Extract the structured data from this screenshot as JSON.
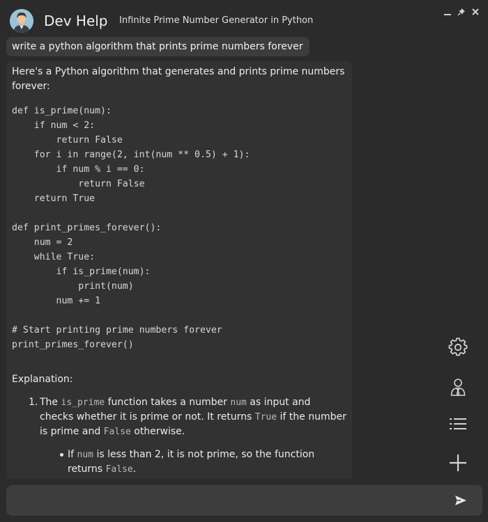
{
  "header": {
    "app_title": "Dev Help",
    "conversation_title": "Infinite Prime Number Generator in Python",
    "window_controls": [
      "minimize-icon",
      "pin-icon",
      "close-icon"
    ]
  },
  "messages": {
    "user": "write a python algorithm that prints prime numbers forever",
    "assistant": {
      "intro": "Here's a Python algorithm that generates and prints prime numbers forever:",
      "code_lines": [
        "def is_prime(num):",
        "    if num < 2:",
        "        return False",
        "    for i in range(2, int(num ** 0.5) + 1):",
        "        if num % i == 0:",
        "            return False",
        "    return True",
        "",
        "def print_primes_forever():",
        "    num = 2",
        "    while True:",
        "        if is_prime(num):",
        "            print(num)",
        "        num += 1",
        "",
        "# Start printing prime numbers forever",
        "print_primes_forever()"
      ],
      "explanation_title": "Explanation:",
      "explanation_items": [
        {
          "number": "1.",
          "parts": [
            {
              "text": "The ",
              "code": false
            },
            {
              "text": "is_prime",
              "code": true
            },
            {
              "text": " function takes a number ",
              "code": false
            },
            {
              "text": "num",
              "code": true
            },
            {
              "text": " as input and checks whether it is prime or not. It returns ",
              "code": false
            },
            {
              "text": "True",
              "code": true
            },
            {
              "text": " if the number is prime and ",
              "code": false
            },
            {
              "text": "False",
              "code": true
            },
            {
              "text": " otherwise.",
              "code": false
            }
          ],
          "sub_items": [
            {
              "parts": [
                {
                  "text": "If ",
                  "code": false
                },
                {
                  "text": "num",
                  "code": true
                },
                {
                  "text": " is less than 2, it is not prime, so the function returns ",
                  "code": false
                },
                {
                  "text": "False",
                  "code": true
                },
                {
                  "text": ".",
                  "code": false
                }
              ]
            }
          ]
        }
      ]
    }
  },
  "toolbar": {
    "buttons": [
      "gear-icon",
      "agent-icon",
      "list-icon",
      "plus-icon"
    ]
  },
  "input": {
    "value": "",
    "placeholder": "",
    "send_icon": "send-icon"
  },
  "colors": {
    "background": "#2b2b2b",
    "panel": "#323232",
    "bubble": "#3c3c3c",
    "input": "#3d3d3d",
    "text": "#ececec",
    "inline_code": "#b9b9b9"
  }
}
